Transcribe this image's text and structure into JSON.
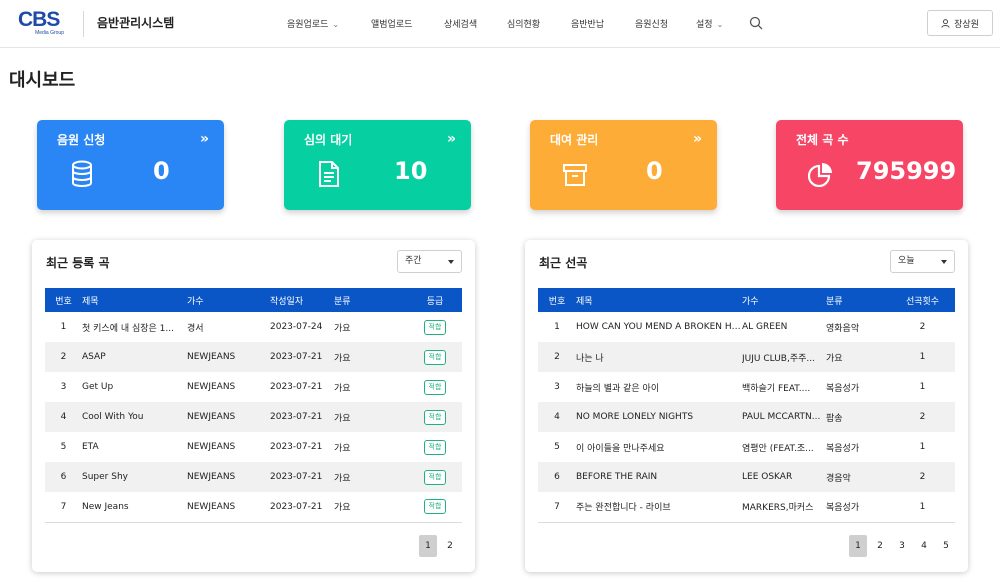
{
  "header": {
    "logo_main": "CBS",
    "logo_sub": "Media Group",
    "system_title": "음반관리시스템",
    "nav": [
      "음원업로드",
      "앨범업로드",
      "상세검색",
      "심의현황",
      "음반반납",
      "음원신청",
      "설정"
    ],
    "user_name": "장상원"
  },
  "page_title": "대시보드",
  "cards": [
    {
      "title": "음원 신청",
      "value": "0",
      "color": "#2a86f5",
      "icon": "database-icon"
    },
    {
      "title": "심의 대기",
      "value": "10",
      "color": "#06cfa2",
      "icon": "document-icon"
    },
    {
      "title": "대여 관리",
      "value": "0",
      "color": "#fdac38",
      "icon": "archive-box-icon"
    },
    {
      "title": "전체 곡 수",
      "value": "795999",
      "color": "#f74565",
      "icon": "pie-chart-icon"
    }
  ],
  "recent": {
    "title": "최근 등록 곡",
    "select_value": "주간",
    "columns": [
      "번호",
      "제목",
      "가수",
      "작성일자",
      "분류",
      "등급"
    ],
    "rows": [
      {
        "no": "1",
        "title": "첫 키스에 내 심장은 1...",
        "artist": "경서",
        "date": "2023-07-24",
        "genre": "가요",
        "grade": "적합"
      },
      {
        "no": "2",
        "title": "ASAP",
        "artist": "NEWJEANS",
        "date": "2023-07-21",
        "genre": "가요",
        "grade": "적합"
      },
      {
        "no": "3",
        "title": "Get Up",
        "artist": "NEWJEANS",
        "date": "2023-07-21",
        "genre": "가요",
        "grade": "적합"
      },
      {
        "no": "4",
        "title": "Cool With You",
        "artist": "NEWJEANS",
        "date": "2023-07-21",
        "genre": "가요",
        "grade": "적합"
      },
      {
        "no": "5",
        "title": "ETA",
        "artist": "NEWJEANS",
        "date": "2023-07-21",
        "genre": "가요",
        "grade": "적합"
      },
      {
        "no": "6",
        "title": "Super Shy",
        "artist": "NEWJEANS",
        "date": "2023-07-21",
        "genre": "가요",
        "grade": "적합"
      },
      {
        "no": "7",
        "title": "New Jeans",
        "artist": "NEWJEANS",
        "date": "2023-07-21",
        "genre": "가요",
        "grade": "적합"
      }
    ],
    "pages": [
      "1",
      "2"
    ]
  },
  "selections": {
    "title": "최근 선곡",
    "select_value": "오늘",
    "columns": [
      "번호",
      "제목",
      "가수",
      "분류",
      "선곡횟수"
    ],
    "rows": [
      {
        "no": "1",
        "title": "HOW CAN YOU MEND A BROKEN HE...",
        "artist": "AL GREEN",
        "genre": "영화음악",
        "count": "2"
      },
      {
        "no": "2",
        "title": "나는 나",
        "artist": "JUJU CLUB,주주...",
        "genre": "가요",
        "count": "1"
      },
      {
        "no": "3",
        "title": "하늘의 별과 같은 아이",
        "artist": "백하슬기 FEAT....",
        "genre": "복음성가",
        "count": "1"
      },
      {
        "no": "4",
        "title": "NO MORE LONELY NIGHTS",
        "artist": "PAUL MCCARTN...",
        "genre": "팝송",
        "count": "2"
      },
      {
        "no": "5",
        "title": "이 아이들을 만나주세요",
        "artist": "염평안 (FEAT.조...",
        "genre": "복음성가",
        "count": "1"
      },
      {
        "no": "6",
        "title": "BEFORE THE RAIN",
        "artist": "LEE OSKAR",
        "genre": "경음악",
        "count": "2"
      },
      {
        "no": "7",
        "title": "주는 완전합니다 - 라이브",
        "artist": "MARKERS,마커스",
        "genre": "복음성가",
        "count": "1"
      }
    ],
    "pages": [
      "1",
      "2",
      "3",
      "4",
      "5"
    ]
  }
}
